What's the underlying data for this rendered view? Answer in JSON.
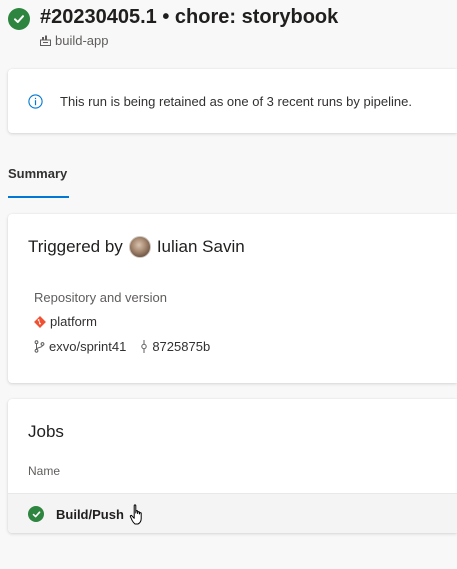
{
  "run": {
    "title": "#20230405.1 • chore: storybook",
    "pipeline": "build-app",
    "status_color": "#2e8540"
  },
  "info_banner": {
    "icon": "info-icon",
    "text": "This run is being retained as one of 3 recent runs by pipeline."
  },
  "tabs": [
    {
      "label": "Summary",
      "selected": true
    }
  ],
  "summary": {
    "triggered_by_label": "Triggered by",
    "user_name": "Iulian Savin",
    "repo_section_label": "Repository and version",
    "repository": "platform",
    "branch": "exvo/sprint41",
    "commit": "8725875b"
  },
  "jobs": {
    "title": "Jobs",
    "column_name": "Name",
    "items": [
      {
        "name": "Build/Push",
        "status": "succeeded"
      }
    ]
  },
  "colors": {
    "accent": "#0078d4",
    "success": "#2e8540",
    "git": "#f05133"
  }
}
